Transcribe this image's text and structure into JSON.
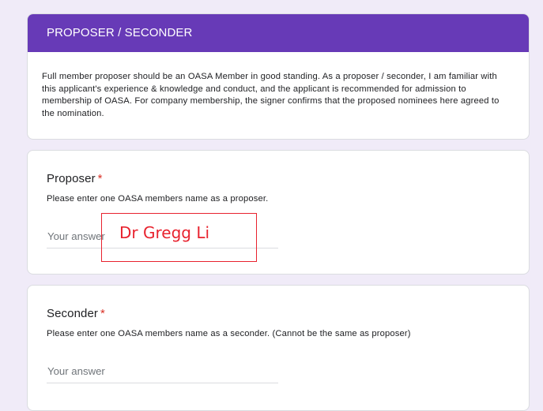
{
  "section": {
    "title": "PROPOSER / SECONDER",
    "description": "Full member proposer should be an OASA Member in good standing.  As a proposer / seconder, I am familiar with this applicant's experience & knowledge and conduct, and the applicant is recommended for admission to membership of OASA. For company membership, the signer confirms that the proposed nominees here agreed to the nomination."
  },
  "questions": [
    {
      "title": "Proposer",
      "required_marker": "*",
      "help_text": "Please enter one OASA members name as a proposer.",
      "placeholder": "Your answer",
      "value": ""
    },
    {
      "title": "Seconder",
      "required_marker": "*",
      "help_text": "Please enter one OASA members name as a seconder. (Cannot be the same as proposer)",
      "placeholder": "Your answer",
      "value": ""
    }
  ],
  "annotation": {
    "text": "Dr Gregg Li",
    "color": "#e8222e"
  },
  "colors": {
    "header": "#673ab7",
    "background": "#f0ebf8",
    "required": "#d93025"
  }
}
